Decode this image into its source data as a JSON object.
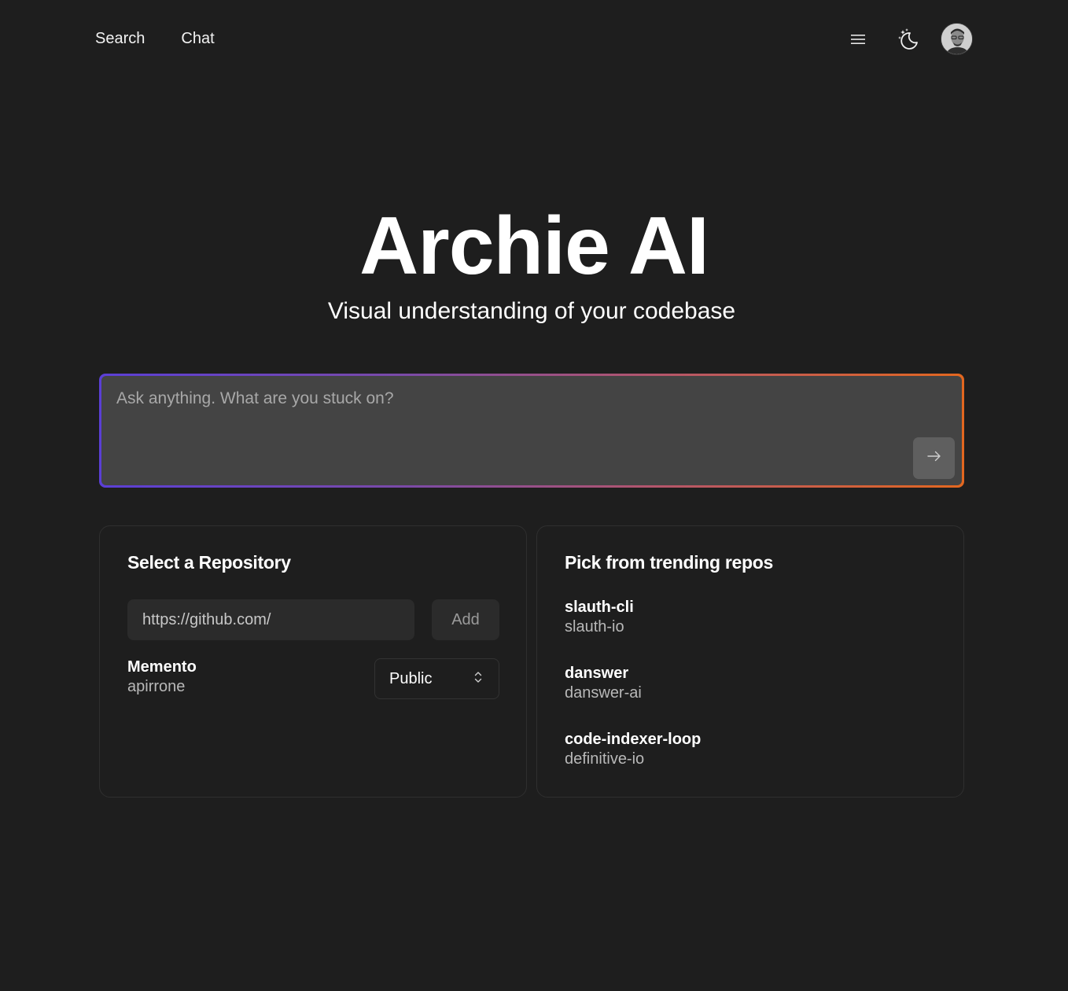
{
  "nav": {
    "search": "Search",
    "chat": "Chat",
    "menu_icon": "menu-icon",
    "theme_icon": "moon-stars-icon"
  },
  "hero": {
    "title": "Archie AI",
    "subtitle": "Visual understanding of your codebase"
  },
  "ask": {
    "placeholder": "Ask anything. What are you stuck on?",
    "value": "",
    "send_icon": "arrow-right-icon",
    "gradient_colors": [
      "#5b3fd6",
      "#e3671f"
    ]
  },
  "repository": {
    "title": "Select a Repository",
    "url_placeholder": "https://github.com/",
    "add_label": "Add",
    "selected": {
      "name": "Memento",
      "owner": "apirrone"
    },
    "visibility": "Public"
  },
  "trending": {
    "title": "Pick from trending repos",
    "items": [
      {
        "name": "slauth-cli",
        "owner": "slauth-io"
      },
      {
        "name": "danswer",
        "owner": "danswer-ai"
      },
      {
        "name": "code-indexer-loop",
        "owner": "definitive-io"
      }
    ]
  },
  "colors": {
    "background": "#1e1e1e",
    "input_bg": "#444444",
    "field_bg": "#2b2b2b"
  }
}
